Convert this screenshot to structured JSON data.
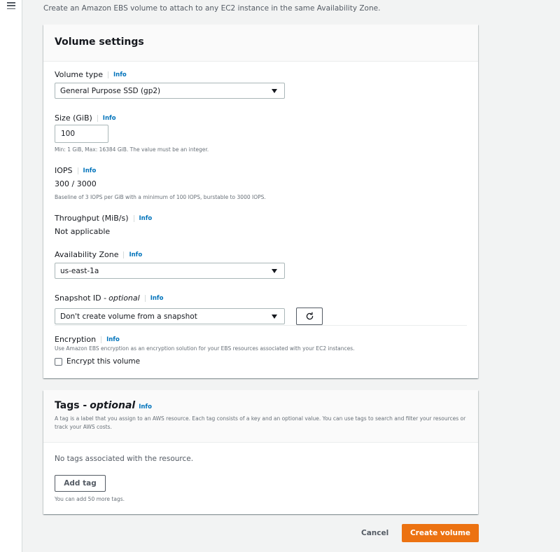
{
  "intro_text": "Create an Amazon EBS volume to attach to any EC2 instance in the same Availability Zone.",
  "volume_settings": {
    "title": "Volume settings",
    "info_label": "Info",
    "volume_type": {
      "label": "Volume type",
      "value": "General Purpose SSD (gp2)"
    },
    "size": {
      "label": "Size (GiB)",
      "value": "100",
      "hint": "Min: 1 GiB, Max: 16384 GiB. The value must be an integer."
    },
    "iops": {
      "label": "IOPS",
      "value": "300 / 3000",
      "hint": "Baseline of 3 IOPS per GiB with a minimum of 100 IOPS, burstable to 3000 IOPS."
    },
    "throughput": {
      "label": "Throughput (MiB/s)",
      "value": "Not applicable"
    },
    "availability_zone": {
      "label": "Availability Zone",
      "value": "us-east-1a"
    },
    "snapshot": {
      "label": "Snapshot ID - ",
      "label_optional": "optional",
      "value": "Don't create volume from a snapshot"
    },
    "encryption": {
      "label": "Encryption",
      "description": "Use Amazon EBS encryption as an encryption solution for your EBS resources associated with your EC2 instances.",
      "checkbox_label": "Encrypt this volume",
      "checked": false
    }
  },
  "tags": {
    "title": "Tags - ",
    "title_optional": "optional",
    "info_label": "Info",
    "description": "A tag is a label that you assign to an AWS resource. Each tag consists of a key and an optional value. You can use tags to search and filter your resources or track your AWS costs.",
    "empty_text": "No tags associated with the resource.",
    "add_button": "Add tag",
    "limit_hint": "You can add 50 more tags."
  },
  "footer": {
    "cancel": "Cancel",
    "create": "Create volume"
  },
  "colors": {
    "primary": "#ec7211",
    "link": "#0073bb",
    "background": "#f2f3f3"
  },
  "icons": {
    "menu": "hamburger-menu-icon",
    "dropdown": "caret-down-icon",
    "refresh": "refresh-icon"
  }
}
